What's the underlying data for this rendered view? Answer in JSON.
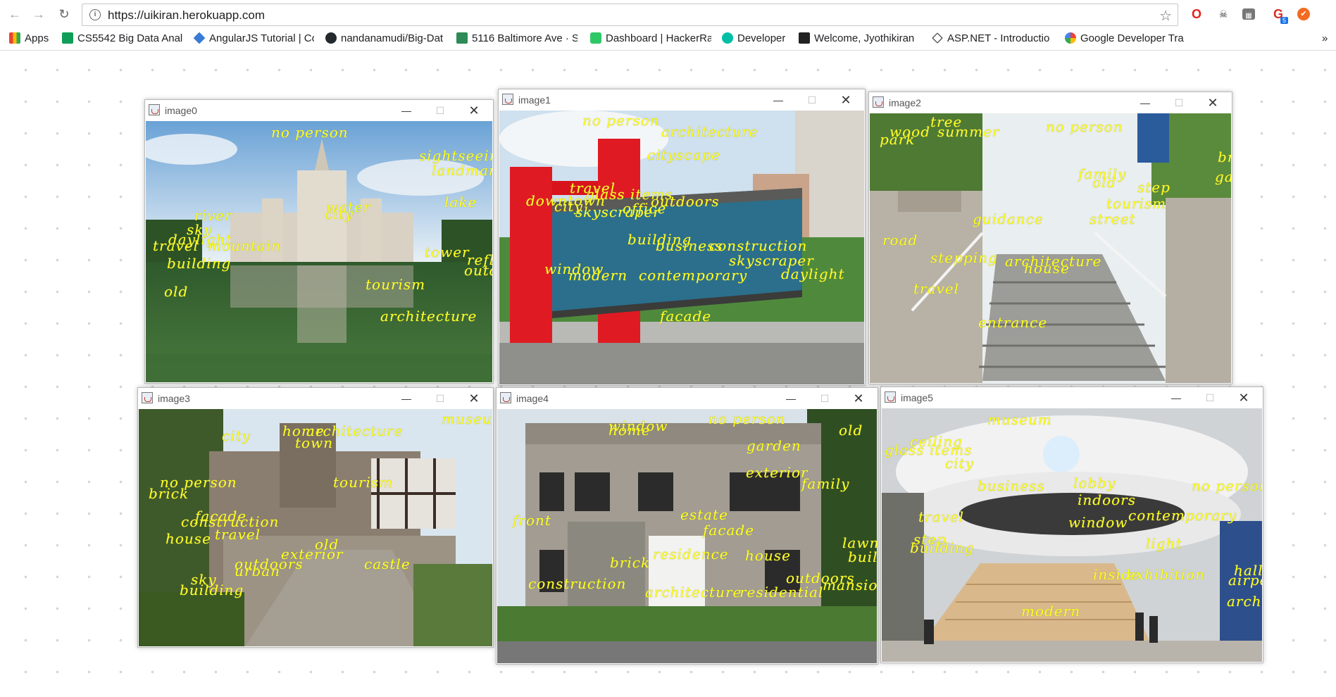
{
  "browser": {
    "url": "https://uikiran.herokuapp.com",
    "extension_badge": "5",
    "bookmarks": [
      {
        "label": "Apps",
        "icon": "apps-grid-icon",
        "color": "#4285f4"
      },
      {
        "label": "CS5542 Big Data Anal",
        "icon": "sheets-icon",
        "color": "#0f9d58"
      },
      {
        "label": "AngularJS Tutorial | Co",
        "icon": "angular-icon",
        "color": "#3a7bd5"
      },
      {
        "label": "nandanamudi/Big-Dat",
        "icon": "github-icon",
        "color": "#24292e"
      },
      {
        "label": "5116 Baltimore Ave · S",
        "icon": "home-icon",
        "color": "#2e8b57"
      },
      {
        "label": "Dashboard | HackerRa",
        "icon": "hackerrank-icon",
        "color": "#2ec866"
      },
      {
        "label": "Developer",
        "icon": "developer-icon",
        "color": "#00bfa5"
      },
      {
        "label": "Welcome, Jyothikiran",
        "icon": "bb-icon",
        "color": "#222222"
      },
      {
        "label": "ASP.NET - Introductio",
        "icon": "aspnet-icon",
        "color": "#555555"
      },
      {
        "label": "Google Developer Tra",
        "icon": "google-icon",
        "color": "#ea4335"
      }
    ],
    "overflow": "»"
  },
  "windows": [
    {
      "title": "image0",
      "tags": [
        "no person",
        "sightseeing",
        "landmark",
        "water",
        "city",
        "lake",
        "river",
        "sky",
        "daylight",
        "travel",
        "mountain",
        "tower",
        "building",
        "reflection",
        "outdoors",
        "tourism",
        "old",
        "architecture"
      ]
    },
    {
      "title": "image1",
      "tags": [
        "no person",
        "architecture",
        "cityscape",
        "travel",
        "glass items",
        "downtown",
        "city",
        "skyscraper",
        "office",
        "outdoors",
        "building",
        "business",
        "construction",
        "skyscraper",
        "window",
        "modern",
        "contemporary",
        "daylight",
        "facade"
      ]
    },
    {
      "title": "image2",
      "tags": [
        "tree",
        "wood",
        "summer",
        "park",
        "no person",
        "family",
        "old",
        "step",
        "tourism",
        "guidance",
        "street",
        "road",
        "stepping",
        "architecture",
        "house",
        "travel",
        "entrance",
        "bridge",
        "garden"
      ]
    },
    {
      "title": "image3",
      "tags": [
        "museum",
        "city",
        "home",
        "architecture",
        "town",
        "no person",
        "tourism",
        "brick",
        "facade",
        "construction",
        "house",
        "travel",
        "old",
        "exterior",
        "outdoors",
        "castle",
        "urban",
        "sky",
        "building"
      ]
    },
    {
      "title": "image4",
      "tags": [
        "window",
        "home",
        "no person",
        "old",
        "garden",
        "exterior",
        "family",
        "front",
        "estate",
        "facade",
        "lawn",
        "residence",
        "house",
        "building",
        "brick",
        "outdoors",
        "construction",
        "architecture",
        "residential",
        "mansion"
      ]
    },
    {
      "title": "image5",
      "tags": [
        "museum",
        "ceiling",
        "glass items",
        "city",
        "lobby",
        "business",
        "no person",
        "indoors",
        "travel",
        "contemporary",
        "window",
        "step",
        "building",
        "light",
        "inside",
        "exhibition",
        "hall",
        "airport",
        "architecture",
        "modern"
      ]
    }
  ]
}
